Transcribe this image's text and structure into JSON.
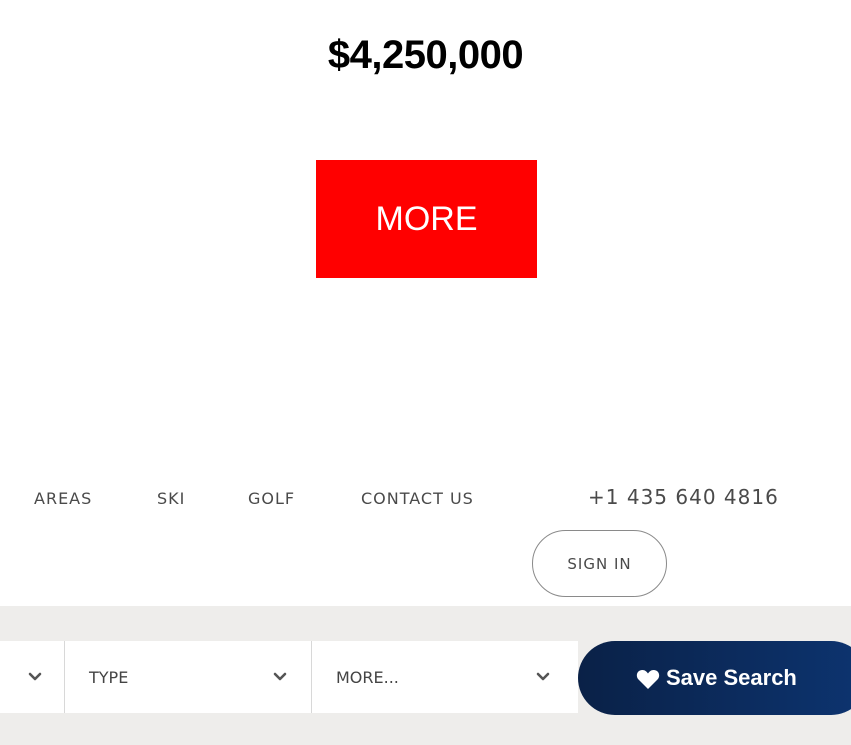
{
  "listing": {
    "price": "$4,250,000",
    "more_label": "MORE",
    "more_color": "#ff0000"
  },
  "nav": {
    "items": [
      "AREAS",
      "SKI",
      "GOLF",
      "CONTACT US"
    ],
    "phone": "+1 435 640 4816",
    "sign_in": "SIGN IN"
  },
  "search_bar": {
    "type_label": "TYPE",
    "more_label": "MORE...",
    "save_label": "Save Search",
    "save_color": "#0a2147"
  }
}
